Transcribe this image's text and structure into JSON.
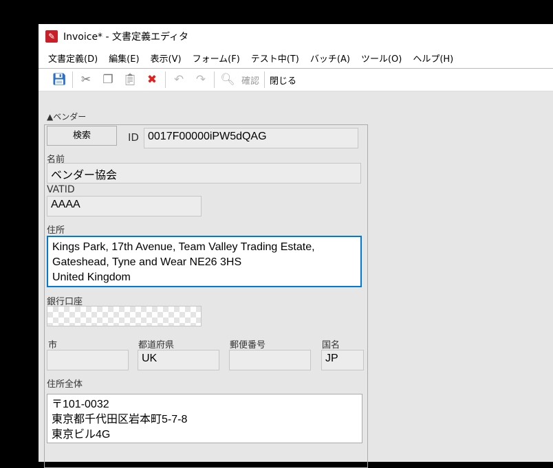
{
  "window": {
    "title": "Invoice* - 文書定義エディタ"
  },
  "menu": [
    "文書定義(D)",
    "編集(E)",
    "表示(V)",
    "フォーム(F)",
    "テスト中(T)",
    "バッチ(A)",
    "ツール(O)",
    "ヘルプ(H)"
  ],
  "toolbar": {
    "confirm": "確認",
    "close": "閉じる"
  },
  "section": "▲ベンダー",
  "search_button": "検索",
  "id": {
    "label": "ID",
    "value": "0017F00000iPW5dQAG"
  },
  "name": {
    "label": "名前",
    "value": "ベンダー協会"
  },
  "vatid": {
    "label": "VATID",
    "value": "AAAA"
  },
  "address": {
    "label": "住所",
    "value": "Kings Park, 17th Avenue, Team Valley Trading Estate,\nGateshead, Tyne and Wear NE26 3HS\nUnited Kingdom"
  },
  "bank": {
    "label": "銀行口座",
    "value": ""
  },
  "city": {
    "label": "市",
    "value": ""
  },
  "prefecture": {
    "label": "都道府県",
    "value": "UK"
  },
  "postal": {
    "label": "郵便番号",
    "value": ""
  },
  "country": {
    "label": "国名",
    "value": "JP"
  },
  "full_address": {
    "label": "住所全体",
    "value": "〒101-0032\n東京都千代田区岩本町5-7-8\n東京ビル4G"
  },
  "colors": {
    "focus": "#0078d7"
  }
}
